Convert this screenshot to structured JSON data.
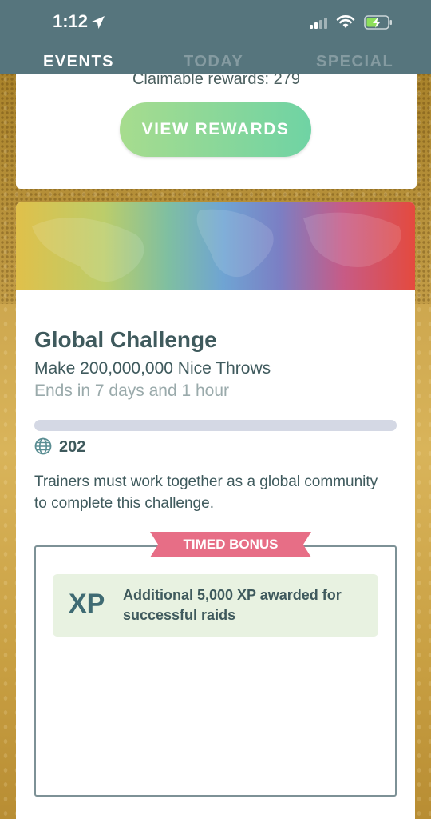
{
  "status_bar": {
    "time": "1:12"
  },
  "tabs": [
    {
      "label": "EVENTS",
      "active": true
    },
    {
      "label": "TODAY",
      "active": false
    },
    {
      "label": "SPECIAL",
      "active": false
    }
  ],
  "rewards_card": {
    "claimable_text": "Claimable rewards: 279",
    "button_label": "VIEW REWARDS"
  },
  "challenge": {
    "title": "Global Challenge",
    "goal": "Make 200,000,000 Nice Throws",
    "ends": "Ends in 7 days and 1 hour",
    "progress_fraction": 0.0,
    "participants": "202",
    "description": "Trainers must work together as a global community to complete this challenge.",
    "bonus_ribbon": "TIMED BONUS",
    "bonus_items": [
      {
        "icon_text": "XP",
        "text": "Additional 5,000 XP awarded for successful raids"
      }
    ]
  },
  "colors": {
    "header_bg": "#56757d",
    "button_gradient_start": "#a7dc8e",
    "button_gradient_end": "#6fd3a4",
    "ribbon": "#e76e86",
    "bonus_item_bg": "#e8f2e1",
    "text_primary": "#3f5a5d"
  },
  "icons": {
    "location": "location-arrow-icon",
    "signal": "cell-signal-icon",
    "wifi": "wifi-icon",
    "battery": "battery-charging-icon",
    "globe": "globe-icon"
  }
}
